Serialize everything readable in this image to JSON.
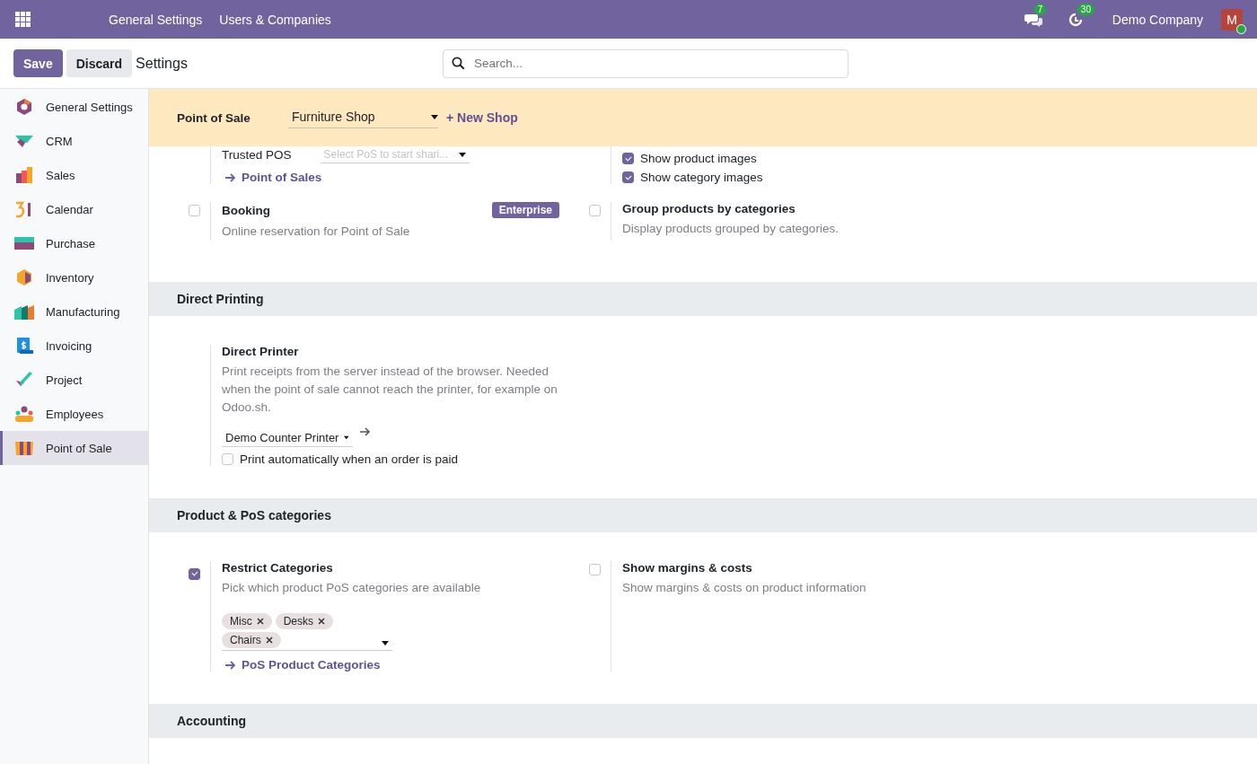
{
  "navbar": {
    "menu": [
      {
        "label": "General Settings"
      },
      {
        "label": "Users & Companies"
      }
    ],
    "messages_badge": "7",
    "activities_badge": "30",
    "company": "Demo Company",
    "avatar": "M"
  },
  "control_panel": {
    "save": "Save",
    "discard": "Discard",
    "title": "Settings",
    "search": {
      "placeholder": "Search..."
    }
  },
  "sidebar": {
    "items": [
      {
        "label": "General Settings",
        "selected": false
      },
      {
        "label": "CRM",
        "selected": false
      },
      {
        "label": "Sales",
        "selected": false
      },
      {
        "label": "Calendar",
        "selected": false
      },
      {
        "label": "Purchase",
        "selected": false
      },
      {
        "label": "Inventory",
        "selected": false
      },
      {
        "label": "Manufacturing",
        "selected": false
      },
      {
        "label": "Invoicing",
        "selected": false
      },
      {
        "label": "Project",
        "selected": false
      },
      {
        "label": "Employees",
        "selected": false
      },
      {
        "label": "Point of Sale",
        "selected": true
      }
    ]
  },
  "banner": {
    "label": "Point of Sale",
    "shop": "Furniture Shop",
    "new_shop": "+ New Shop"
  },
  "sections": [
    {
      "settings": [
        {
          "kind": "plain",
          "parts": [
            {
              "kind": "labeled_select",
              "label": "Trusted POS",
              "placeholder": "Select PoS to start shari..."
            },
            {
              "kind": "link",
              "label": "Point of Sales"
            }
          ]
        },
        {
          "kind": "plain",
          "parts": [
            {
              "kind": "option",
              "label": "Show product images",
              "checked": true
            },
            {
              "kind": "option",
              "label": "Show category images",
              "checked": true
            }
          ]
        },
        {
          "kind": "checkbox",
          "checked": false,
          "title": "Booking",
          "badge": "Enterprise",
          "description": "Online reservation for Point of Sale"
        },
        {
          "kind": "checkbox",
          "checked": false,
          "title": "Group products by categories",
          "description": "Display products grouped by categories."
        }
      ]
    },
    {
      "title": "Direct Printing",
      "settings": [
        {
          "kind": "plain",
          "title": "Direct Printer",
          "description": "Print receipts from the server instead of the browser. Needed when the point of sale cannot reach the printer, for example on Odoo.sh.",
          "parts": [
            {
              "kind": "select",
              "value": "Demo Counter Printer"
            },
            {
              "kind": "option",
              "label": "Print automatically when an order is paid",
              "checked": false
            }
          ]
        }
      ]
    },
    {
      "title": "Product & PoS categories",
      "settings": [
        {
          "kind": "checkbox",
          "checked": true,
          "title": "Restrict Categories",
          "description": "Pick which product PoS categories are available",
          "parts": [
            {
              "kind": "tags",
              "tags": [
                "Misc",
                "Desks",
                "Chairs"
              ]
            },
            {
              "kind": "link",
              "label": "PoS Product Categories"
            }
          ]
        },
        {
          "kind": "checkbox",
          "checked": false,
          "title": "Show margins & costs",
          "description": "Show margins & costs on product information"
        }
      ]
    },
    {
      "title": "Accounting"
    }
  ]
}
